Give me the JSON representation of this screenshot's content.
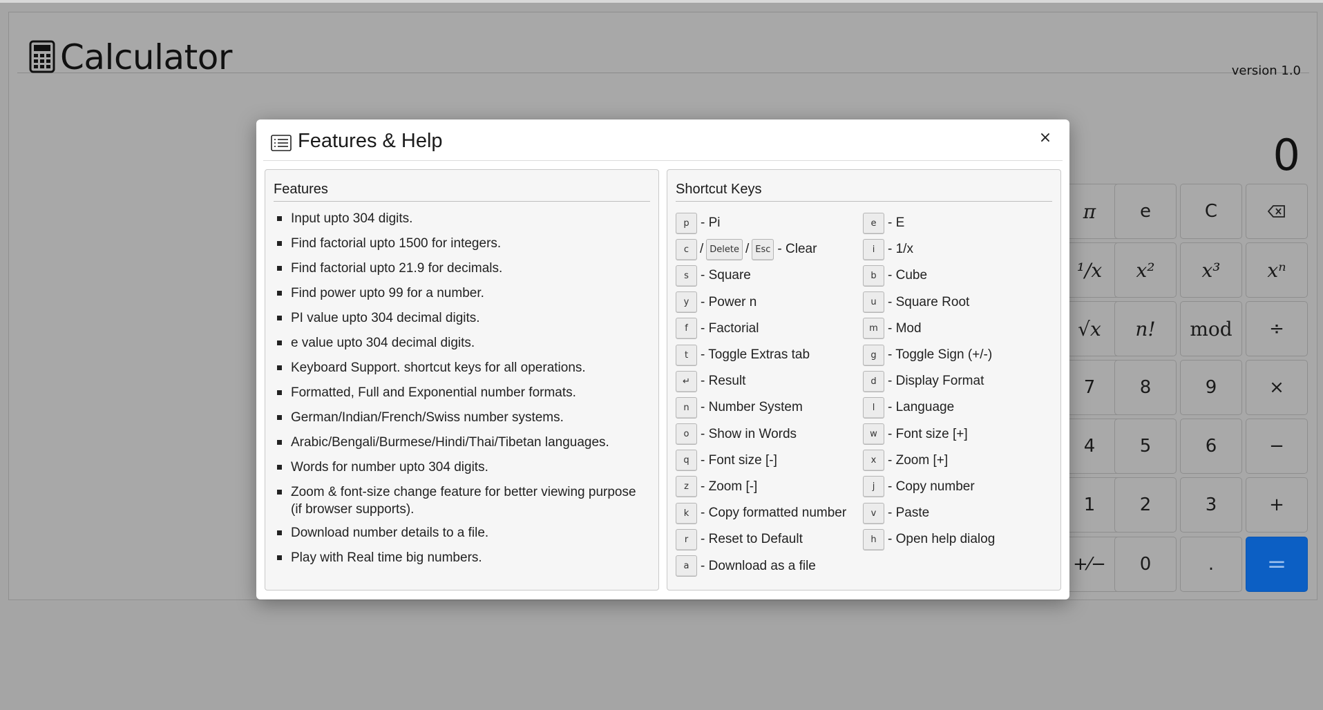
{
  "app": {
    "title": "Calculator",
    "version": "version 1.0",
    "display_value": "0",
    "keys": {
      "pi": "π",
      "e": "e",
      "clear": "C",
      "backspace": "⌫",
      "reciprocal": "¹/x",
      "square": "x²",
      "cube": "x³",
      "power": "xⁿ",
      "sqrt": "√x",
      "factorial": "n!",
      "mod": "mod",
      "divide": "÷",
      "k7": "7",
      "k8": "8",
      "k9": "9",
      "multiply": "×",
      "k4": "4",
      "k5": "5",
      "k6": "6",
      "minus": "−",
      "k1": "1",
      "k2": "2",
      "k3": "3",
      "plus": "+",
      "sign": "+⁄−",
      "k0": "0",
      "dot": ".",
      "equals": "="
    },
    "accent_color": "#0c5fc4"
  },
  "modal": {
    "title": "Features & Help",
    "close_label": "×",
    "features": {
      "title": "Features",
      "items": [
        "Input upto 304 digits.",
        "Find factorial upto 1500 for integers.",
        "Find factorial upto 21.9 for decimals.",
        "Find power upto 99 for a number.",
        "PI value upto 304 decimal digits.",
        "e value upto 304 decimal digits.",
        "Keyboard Support. shortcut keys for all operations.",
        "Formatted, Full and Exponential number formats.",
        "German/Indian/French/Swiss number systems.",
        "Arabic/Bengali/Burmese/Hindi/Thai/Tibetan languages.",
        "Words for number upto 304 digits.",
        "Zoom & font-size change feature for better viewing purpose (if browser supports).",
        "Download number details to a file.",
        "Play with Real time big numbers."
      ]
    },
    "shortcuts": {
      "title": "Shortcut Keys",
      "left": [
        {
          "key": "p",
          "desc": "- Pi"
        },
        {
          "key": "c",
          "key2": "Delete",
          "key3": "Esc",
          "sep": "/",
          "desc": "- Clear"
        },
        {
          "key": "s",
          "desc": "- Square"
        },
        {
          "key": "y",
          "desc": "- Power n"
        },
        {
          "key": "f",
          "desc": "- Factorial"
        },
        {
          "key": "t",
          "desc": "- Toggle Extras tab"
        },
        {
          "key": "↵",
          "desc": "- Result"
        },
        {
          "key": "n",
          "desc": "- Number System"
        },
        {
          "key": "o",
          "desc": "- Show in Words"
        },
        {
          "key": "q",
          "desc": "- Font size [-]"
        },
        {
          "key": "z",
          "desc": "- Zoom [-]"
        },
        {
          "key": "k",
          "desc": "- Copy formatted number"
        },
        {
          "key": "r",
          "desc": "- Reset to Default"
        },
        {
          "key": "a",
          "desc": "- Download as a file"
        }
      ],
      "right": [
        {
          "key": "e",
          "desc": "- E"
        },
        {
          "key": "i",
          "desc": "- 1/x"
        },
        {
          "key": "b",
          "desc": "- Cube"
        },
        {
          "key": "u",
          "desc": "- Square Root"
        },
        {
          "key": "m",
          "desc": "- Mod"
        },
        {
          "key": "g",
          "desc": "- Toggle Sign (+/-)"
        },
        {
          "key": "d",
          "desc": "- Display Format"
        },
        {
          "key": "l",
          "desc": "- Language"
        },
        {
          "key": "w",
          "desc": "- Font size [+]"
        },
        {
          "key": "x",
          "desc": "- Zoom [+]"
        },
        {
          "key": "j",
          "desc": "- Copy number"
        },
        {
          "key": "v",
          "desc": "- Paste"
        },
        {
          "key": "h",
          "desc": "- Open help dialog"
        }
      ]
    }
  }
}
